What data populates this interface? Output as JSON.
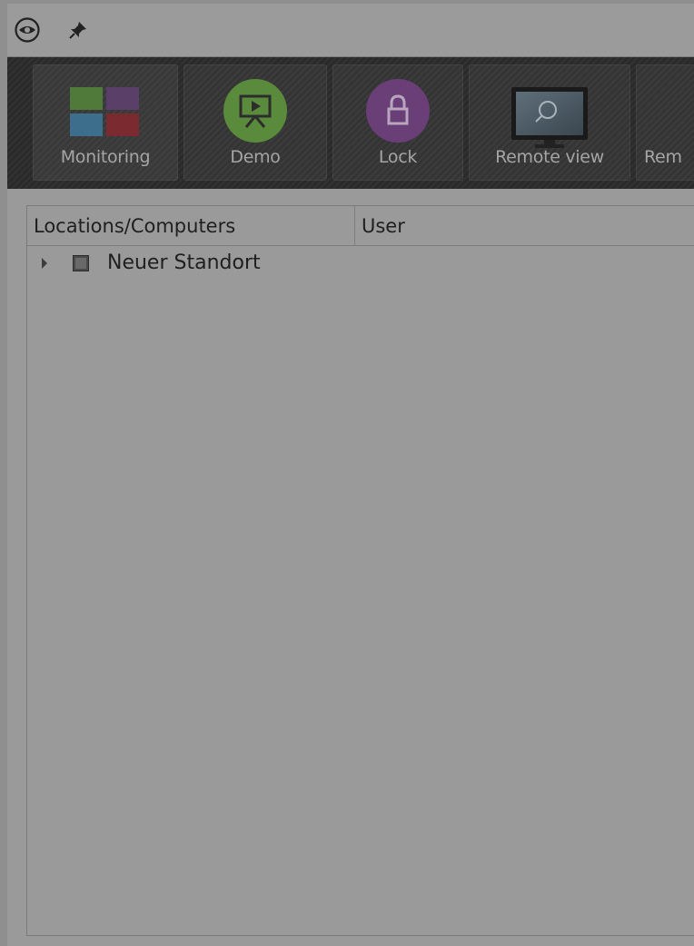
{
  "titlebar": {
    "icons": [
      "eye-icon",
      "pin-icon"
    ]
  },
  "toolbar": {
    "buttons": [
      {
        "label": "Monitoring",
        "icon": "monitoring-icon"
      },
      {
        "label": "Demo",
        "icon": "presentation-icon"
      },
      {
        "label": "Lock",
        "icon": "lock-icon"
      },
      {
        "label": "Remote view",
        "icon": "remote-view-icon"
      },
      {
        "label": "Rem",
        "icon": "monitor-icon"
      }
    ]
  },
  "tree": {
    "columns": [
      "Locations/Computers",
      "User"
    ],
    "rows": [
      {
        "label": "Neuer Standort",
        "expanded": false,
        "checked": "partial"
      }
    ]
  },
  "colors": {
    "toolbar_bg": "#2a2a2a",
    "demo_accent": "#5a8a3b",
    "lock_accent": "#6a3f78",
    "window_bg": "#9a9a9a"
  }
}
